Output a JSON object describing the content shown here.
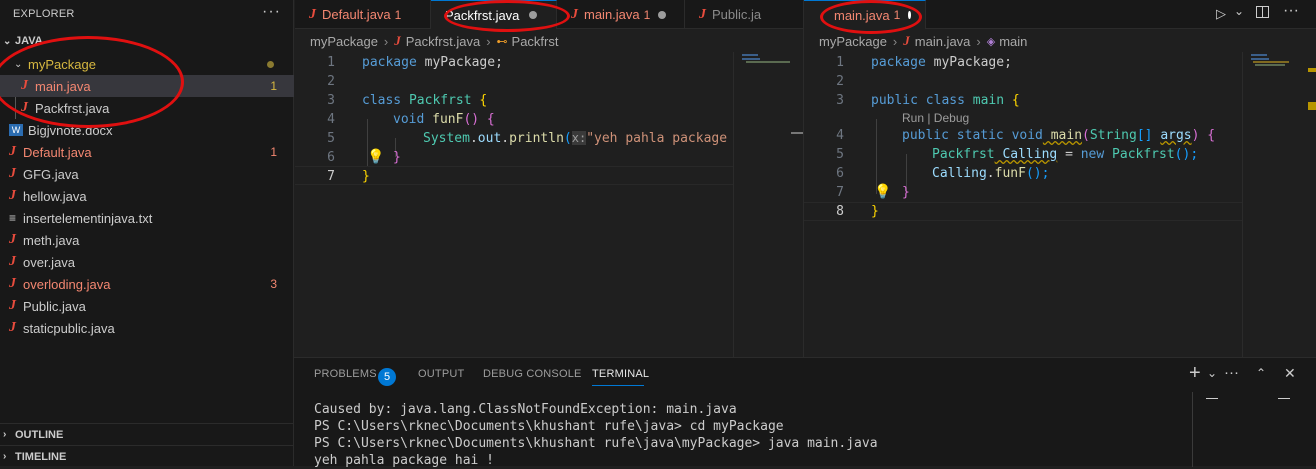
{
  "explorer": {
    "title": "EXPLORER",
    "more": "···",
    "root_label": "JAVA",
    "folder": "myPackage",
    "folder_files": [
      {
        "name": "main.java",
        "badge": "1",
        "icon": "java-icon",
        "error": true
      },
      {
        "name": "Packfrst.java",
        "badge": "",
        "icon": "java-icon",
        "error": false
      }
    ],
    "files": [
      {
        "name": "Bigjvnote.docx",
        "badge": "",
        "icon": "word-icon",
        "error": false
      },
      {
        "name": "Default.java",
        "badge": "1",
        "icon": "java-icon",
        "error": true
      },
      {
        "name": "GFG.java",
        "badge": "",
        "icon": "java-icon",
        "error": false
      },
      {
        "name": "hellow.java",
        "badge": "",
        "icon": "java-icon",
        "error": false
      },
      {
        "name": "insertelementinjava.txt",
        "badge": "",
        "icon": "text-icon",
        "error": false
      },
      {
        "name": "meth.java",
        "badge": "",
        "icon": "java-icon",
        "error": false
      },
      {
        "name": "over.java",
        "badge": "",
        "icon": "java-icon",
        "error": false
      },
      {
        "name": "overloding.java",
        "badge": "3",
        "icon": "java-icon",
        "error": true
      },
      {
        "name": "Public.java",
        "badge": "",
        "icon": "java-icon",
        "error": false
      },
      {
        "name": "staticpublic.java",
        "badge": "",
        "icon": "java-icon",
        "error": false
      }
    ],
    "outline_label": "OUTLINE",
    "timeline_label": "TIMELINE"
  },
  "left_editor": {
    "tabs": [
      {
        "name": "Default.java",
        "badge": "1"
      },
      {
        "name": "Packfrst.java",
        "badge": ""
      },
      {
        "name": "main.java",
        "badge": "1"
      },
      {
        "name": "Public.ja",
        "badge": ""
      }
    ],
    "breadcrumb": {
      "folder": "myPackage",
      "file": "Packfrst.java",
      "symbol": "Packfrst"
    },
    "line_numbers": [
      "1",
      "2",
      "3",
      "4",
      "5",
      "6",
      "7"
    ],
    "code": {
      "l1_kw": "package",
      "l1_rest": " myPackage;",
      "l3_kw": "class",
      "l3_name": " Packfrst ",
      "l3_br": "{",
      "l4_kw": "void",
      "l4_fn": " funF",
      "l4_p": "()",
      "l4_br": " {",
      "l5_obj": "System",
      "l5_dot1": ".",
      "l5_out": "out",
      "l5_dot2": ".",
      "l5_fn": "println",
      "l5_p": "(",
      "l5_hint": "x:",
      "l5_str": "\"yeh pahla package ",
      "l6_br": "}",
      "l7_br": "}"
    }
  },
  "right_editor": {
    "tab": {
      "name": "main.java",
      "badge": "1"
    },
    "breadcrumb": {
      "folder": "myPackage",
      "file": "main.java",
      "symbol": "main"
    },
    "line_numbers": [
      "1",
      "2",
      "3",
      "",
      "4",
      "5",
      "6",
      "7",
      "8"
    ],
    "code": {
      "l1_kw": "package",
      "l1_rest": " myPackage;",
      "l3_kw": "public class",
      "l3_name": " main ",
      "l3_br": "{",
      "codelens": "Run | Debug",
      "l4_kw": "public static void",
      "l4_fn": " main",
      "l4_p1": "(",
      "l4_ty": "String",
      "l4_arr": "[] ",
      "l4_arg": "args",
      "l4_p2": ")",
      "l4_br": " {",
      "l5_ty": "Packfrst",
      "l5_var": " Calling",
      "l5_eq": " = ",
      "l5_new": "new",
      "l5_ty2": " Packfrst",
      "l5_p": "();",
      "l6_var": "Calling",
      "l6_dot": ".",
      "l6_fn": "funF",
      "l6_p": "();",
      "l7_br": "}",
      "l8_br": "}"
    }
  },
  "panel": {
    "tabs": [
      "PROBLEMS",
      "OUTPUT",
      "DEBUG CONSOLE",
      "TERMINAL"
    ],
    "problems_count": "5",
    "terminal_lines": [
      "Caused by: java.lang.ClassNotFoundException: main.java",
      "PS C:\\Users\\rknec\\Documents\\khushant rufe\\java> cd myPackage",
      "PS C:\\Users\\rknec\\Documents\\khushant rufe\\java\\myPackage> java main.java",
      "yeh pahla package hai !"
    ],
    "add_icon": "+",
    "dropdown_icon": "⌄",
    "more": "···"
  },
  "colors": {
    "error": "#f48771",
    "modified": "#d6b740",
    "accent": "#0078d4",
    "annotation": "#e01010"
  }
}
